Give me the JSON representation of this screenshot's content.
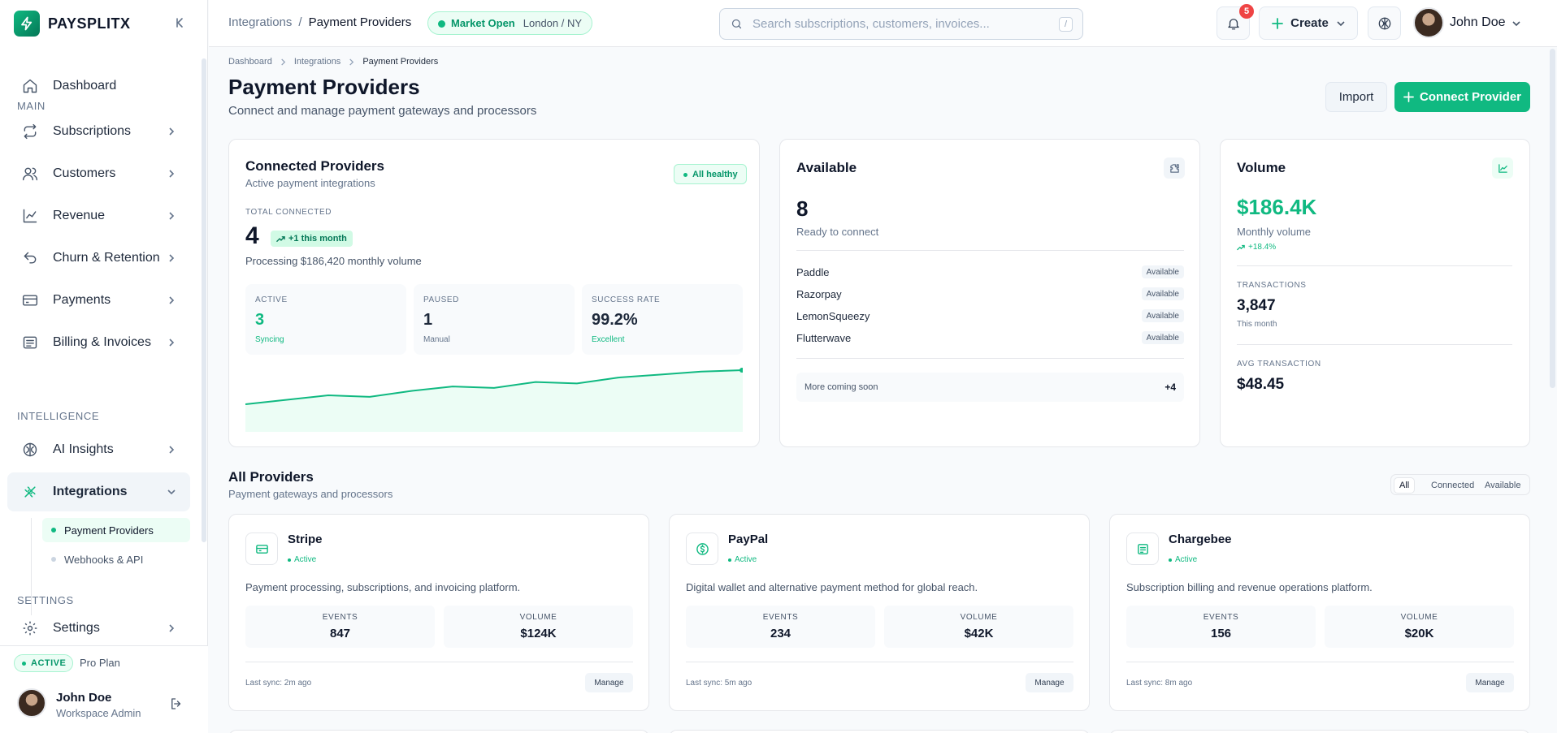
{
  "brand": {
    "name": "PAYSPLITX",
    "collapse_label": "K"
  },
  "sidebar": {
    "items": [
      {
        "label": "Dashboard",
        "icon": "home-icon",
        "has_chevron": false
      },
      {
        "label": "Subscriptions",
        "icon": "repeat-icon",
        "has_chevron": true
      },
      {
        "label": "Customers",
        "icon": "users-icon",
        "has_chevron": true
      },
      {
        "label": "Revenue",
        "icon": "trend-line-icon",
        "has_chevron": true
      },
      {
        "label": "Churn & Retention",
        "icon": "undo-icon",
        "has_chevron": true
      },
      {
        "label": "Payments",
        "icon": "credit-card-icon",
        "has_chevron": true
      },
      {
        "label": "Billing & Invoices",
        "icon": "receipt-icon",
        "has_chevron": true
      },
      {
        "label": "AI Insights",
        "icon": "brain-icon",
        "has_chevron": true
      },
      {
        "label": "Integrations",
        "icon": "plug-icon",
        "has_chevron": true,
        "active": true
      },
      {
        "label": "Settings",
        "icon": "gear-icon",
        "has_chevron": true
      }
    ],
    "sections": {
      "main": "MAIN",
      "intelligence": "INTELLIGENCE",
      "settings": "SETTINGS"
    },
    "sub_items": [
      {
        "label": "Payment Providers",
        "active": true
      },
      {
        "label": "Webhooks & API",
        "active": false
      }
    ],
    "footer": {
      "plan_badge": "ACTIVE",
      "plan_name": "Pro Plan",
      "user_name": "John Doe",
      "user_role": "Workspace Admin"
    }
  },
  "header": {
    "breadcrumb": {
      "parent": "Integrations",
      "separator": "/",
      "current": "Payment Providers"
    },
    "market": {
      "status": "Market Open",
      "location": "London / NY"
    },
    "search": {
      "placeholder": "Search subscriptions, customers, invoices...",
      "value": "",
      "shortcut": "/"
    },
    "notifications": {
      "count": "5"
    },
    "create_label": "Create",
    "user_name": "John Doe"
  },
  "page": {
    "breadcrumb": [
      "Dashboard",
      "Integrations",
      "Payment Providers"
    ],
    "title": "Payment Providers",
    "subtitle": "Connect and manage payment gateways and processors",
    "import_label": "Import",
    "connect_label": "Connect Provider"
  },
  "connected": {
    "title": "Connected Providers",
    "subtitle": "Active payment integrations",
    "health": "All healthy",
    "total_label": "TOTAL CONNECTED",
    "total": "4",
    "trend": "+1 this month",
    "processing": "Processing $186,420 monthly volume",
    "stats": [
      {
        "label": "ACTIVE",
        "value": "3",
        "note": "Syncing"
      },
      {
        "label": "PAUSED",
        "value": "1",
        "note": "Manual"
      },
      {
        "label": "SUCCESS RATE",
        "value": "99.2%",
        "note": "Excellent"
      }
    ],
    "sparkline": [
      7,
      10,
      13,
      12,
      16,
      19,
      18,
      22,
      21,
      25,
      27,
      29,
      30
    ],
    "accent": "#10b981"
  },
  "available": {
    "title": "Available",
    "count": "8",
    "count_label": "Ready to connect",
    "providers": [
      {
        "name": "Paddle",
        "status": "Available"
      },
      {
        "name": "Razorpay",
        "status": "Available"
      },
      {
        "name": "LemonSqueezy",
        "status": "Available"
      },
      {
        "name": "Flutterwave",
        "status": "Available"
      }
    ],
    "coming_soon": "More coming soon",
    "coming_count": "+4"
  },
  "volume": {
    "title": "Volume",
    "amount": "$186.4K",
    "amount_label": "Monthly volume",
    "trend": "+18.4%",
    "transactions_label": "TRANSACTIONS",
    "transactions": "3,847",
    "transactions_period": "This month",
    "avg_label": "AVG TRANSACTION",
    "avg": "$48.45"
  },
  "all_providers": {
    "title": "All Providers",
    "subtitle": "Payment gateways and processors",
    "filters": [
      "All",
      "Connected",
      "Available"
    ],
    "active_filter": "All",
    "cards": [
      {
        "name": "Stripe",
        "status": "Active",
        "icon": "card-icon",
        "description": "Payment processing, subscriptions, and invoicing platform.",
        "events_label": "EVENTS",
        "events": "847",
        "volume_label": "VOLUME",
        "volume": "$124K",
        "last_sync": "Last sync: 2m ago",
        "action": "Manage"
      },
      {
        "name": "PayPal",
        "status": "Active",
        "icon": "dollar-circle-icon",
        "description": "Digital wallet and alternative payment method for global reach.",
        "events_label": "EVENTS",
        "events": "234",
        "volume_label": "VOLUME",
        "volume": "$42K",
        "last_sync": "Last sync: 5m ago",
        "action": "Manage"
      },
      {
        "name": "Chargebee",
        "status": "Active",
        "icon": "invoice-icon",
        "description": "Subscription billing and revenue operations platform.",
        "events_label": "EVENTS",
        "events": "156",
        "volume_label": "VOLUME",
        "volume": "$20K",
        "last_sync": "Last sync: 8m ago",
        "action": "Manage"
      }
    ]
  },
  "colors": {
    "accent": "#10b981",
    "accent_dark": "#059669",
    "danger": "#ef4444",
    "text": "#0f172a",
    "muted": "#64748b"
  }
}
